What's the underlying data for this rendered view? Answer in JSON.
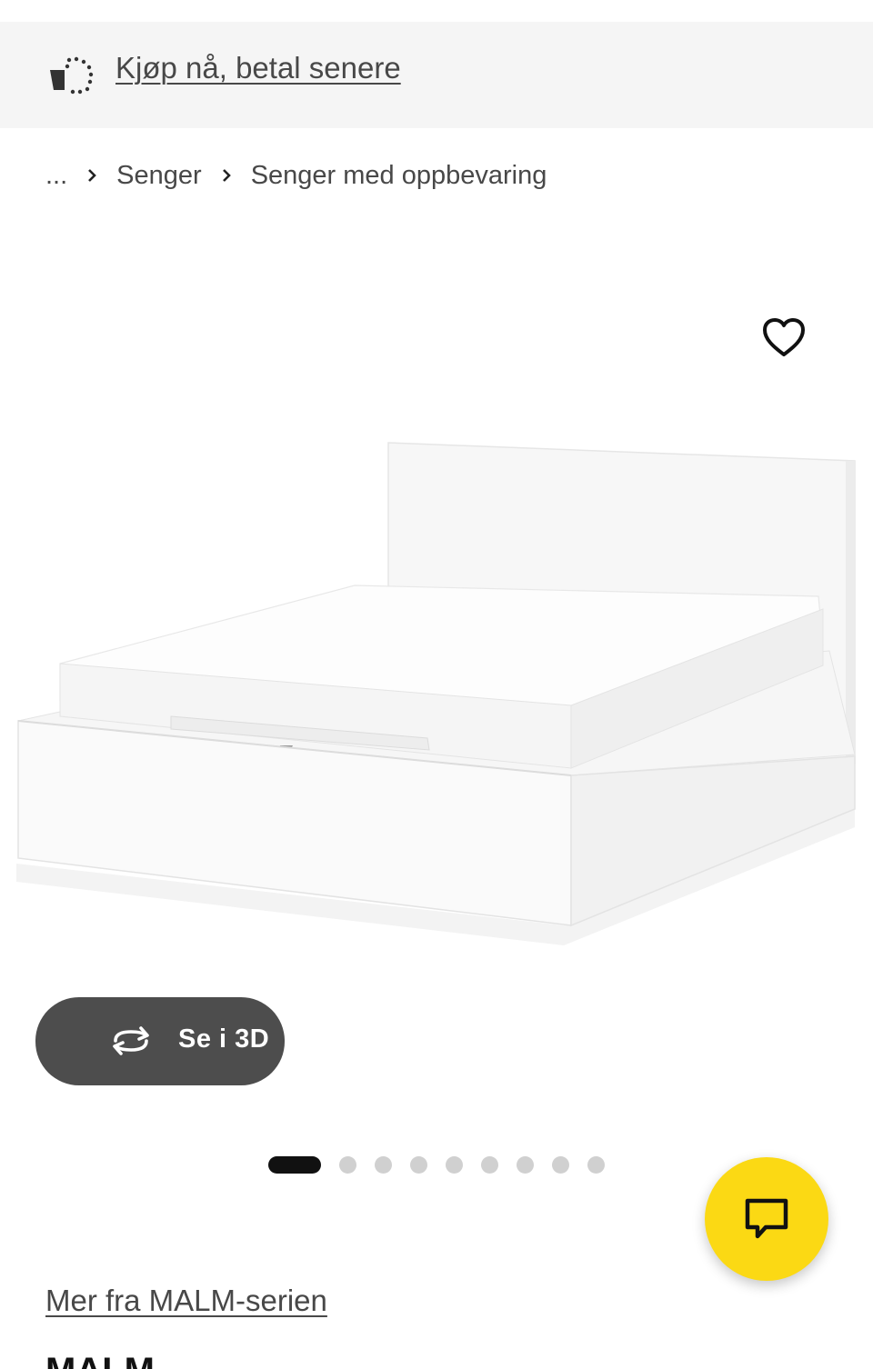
{
  "banner": {
    "icon": "buy-now-pay-later-icon",
    "link_text": "Kjøp nå, betal senere"
  },
  "breadcrumb": {
    "items": [
      "...",
      "Senger",
      "Senger med oppbevaring"
    ]
  },
  "product": {
    "image": "white-storage-bed-image",
    "title_partial": "MALM"
  },
  "view3d": {
    "label": "Se i 3D"
  },
  "carousel": {
    "total_slides": 9,
    "active_index": 0
  },
  "series": {
    "link_text": "Mer fra MALM-serien"
  },
  "colors": {
    "accent": "#fbd914",
    "button_dark": "#4d4d4d",
    "banner_bg": "#f5f5f5"
  }
}
